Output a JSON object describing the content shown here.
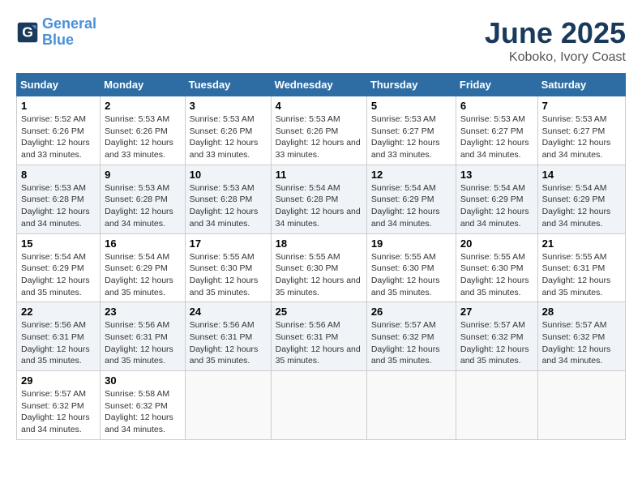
{
  "logo": {
    "line1": "General",
    "line2": "Blue"
  },
  "title": "June 2025",
  "subtitle": "Koboko, Ivory Coast",
  "weekdays": [
    "Sunday",
    "Monday",
    "Tuesday",
    "Wednesday",
    "Thursday",
    "Friday",
    "Saturday"
  ],
  "weeks": [
    [
      {
        "day": "1",
        "sunrise": "5:52 AM",
        "sunset": "6:26 PM",
        "daylight": "12 hours and 33 minutes."
      },
      {
        "day": "2",
        "sunrise": "5:53 AM",
        "sunset": "6:26 PM",
        "daylight": "12 hours and 33 minutes."
      },
      {
        "day": "3",
        "sunrise": "5:53 AM",
        "sunset": "6:26 PM",
        "daylight": "12 hours and 33 minutes."
      },
      {
        "day": "4",
        "sunrise": "5:53 AM",
        "sunset": "6:26 PM",
        "daylight": "12 hours and 33 minutes."
      },
      {
        "day": "5",
        "sunrise": "5:53 AM",
        "sunset": "6:27 PM",
        "daylight": "12 hours and 33 minutes."
      },
      {
        "day": "6",
        "sunrise": "5:53 AM",
        "sunset": "6:27 PM",
        "daylight": "12 hours and 34 minutes."
      },
      {
        "day": "7",
        "sunrise": "5:53 AM",
        "sunset": "6:27 PM",
        "daylight": "12 hours and 34 minutes."
      }
    ],
    [
      {
        "day": "8",
        "sunrise": "5:53 AM",
        "sunset": "6:28 PM",
        "daylight": "12 hours and 34 minutes."
      },
      {
        "day": "9",
        "sunrise": "5:53 AM",
        "sunset": "6:28 PM",
        "daylight": "12 hours and 34 minutes."
      },
      {
        "day": "10",
        "sunrise": "5:53 AM",
        "sunset": "6:28 PM",
        "daylight": "12 hours and 34 minutes."
      },
      {
        "day": "11",
        "sunrise": "5:54 AM",
        "sunset": "6:28 PM",
        "daylight": "12 hours and 34 minutes."
      },
      {
        "day": "12",
        "sunrise": "5:54 AM",
        "sunset": "6:29 PM",
        "daylight": "12 hours and 34 minutes."
      },
      {
        "day": "13",
        "sunrise": "5:54 AM",
        "sunset": "6:29 PM",
        "daylight": "12 hours and 34 minutes."
      },
      {
        "day": "14",
        "sunrise": "5:54 AM",
        "sunset": "6:29 PM",
        "daylight": "12 hours and 34 minutes."
      }
    ],
    [
      {
        "day": "15",
        "sunrise": "5:54 AM",
        "sunset": "6:29 PM",
        "daylight": "12 hours and 35 minutes."
      },
      {
        "day": "16",
        "sunrise": "5:54 AM",
        "sunset": "6:29 PM",
        "daylight": "12 hours and 35 minutes."
      },
      {
        "day": "17",
        "sunrise": "5:55 AM",
        "sunset": "6:30 PM",
        "daylight": "12 hours and 35 minutes."
      },
      {
        "day": "18",
        "sunrise": "5:55 AM",
        "sunset": "6:30 PM",
        "daylight": "12 hours and 35 minutes."
      },
      {
        "day": "19",
        "sunrise": "5:55 AM",
        "sunset": "6:30 PM",
        "daylight": "12 hours and 35 minutes."
      },
      {
        "day": "20",
        "sunrise": "5:55 AM",
        "sunset": "6:30 PM",
        "daylight": "12 hours and 35 minutes."
      },
      {
        "day": "21",
        "sunrise": "5:55 AM",
        "sunset": "6:31 PM",
        "daylight": "12 hours and 35 minutes."
      }
    ],
    [
      {
        "day": "22",
        "sunrise": "5:56 AM",
        "sunset": "6:31 PM",
        "daylight": "12 hours and 35 minutes."
      },
      {
        "day": "23",
        "sunrise": "5:56 AM",
        "sunset": "6:31 PM",
        "daylight": "12 hours and 35 minutes."
      },
      {
        "day": "24",
        "sunrise": "5:56 AM",
        "sunset": "6:31 PM",
        "daylight": "12 hours and 35 minutes."
      },
      {
        "day": "25",
        "sunrise": "5:56 AM",
        "sunset": "6:31 PM",
        "daylight": "12 hours and 35 minutes."
      },
      {
        "day": "26",
        "sunrise": "5:57 AM",
        "sunset": "6:32 PM",
        "daylight": "12 hours and 35 minutes."
      },
      {
        "day": "27",
        "sunrise": "5:57 AM",
        "sunset": "6:32 PM",
        "daylight": "12 hours and 35 minutes."
      },
      {
        "day": "28",
        "sunrise": "5:57 AM",
        "sunset": "6:32 PM",
        "daylight": "12 hours and 34 minutes."
      }
    ],
    [
      {
        "day": "29",
        "sunrise": "5:57 AM",
        "sunset": "6:32 PM",
        "daylight": "12 hours and 34 minutes."
      },
      {
        "day": "30",
        "sunrise": "5:58 AM",
        "sunset": "6:32 PM",
        "daylight": "12 hours and 34 minutes."
      },
      null,
      null,
      null,
      null,
      null
    ]
  ]
}
